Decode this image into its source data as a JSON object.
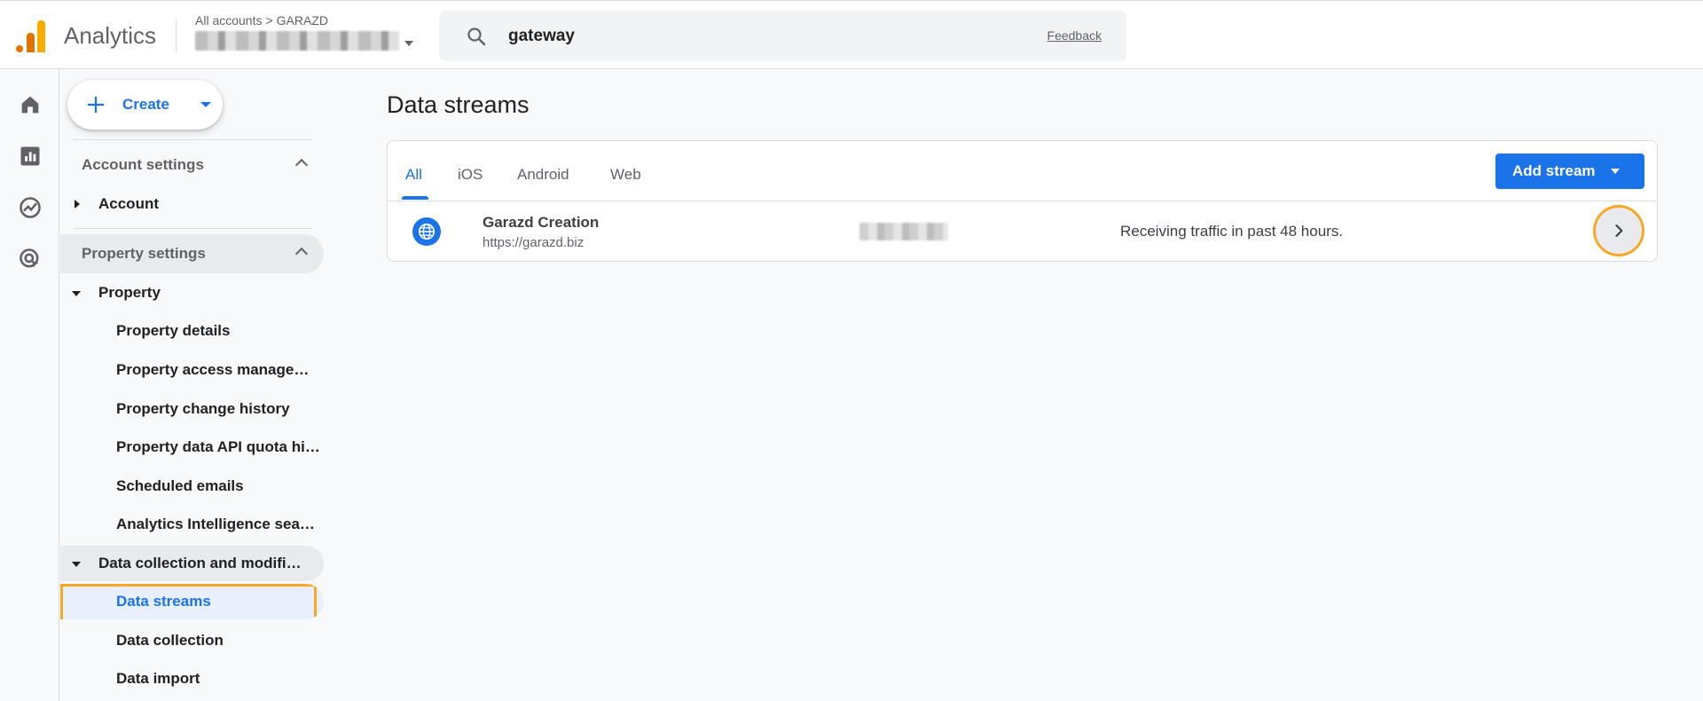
{
  "header": {
    "app_title": "Analytics",
    "breadcrumb": {
      "root": "All accounts",
      "separator": ">",
      "account": "GARAZD"
    },
    "search": {
      "value": "gateway",
      "placeholder": ""
    },
    "feedback_label": "Feedback"
  },
  "rail": {
    "icons": [
      "home-icon",
      "reports-icon",
      "explore-icon",
      "advertising-icon"
    ]
  },
  "nav": {
    "create_label": "Create",
    "account_settings": {
      "title": "Account settings",
      "items": [
        {
          "label": "Account"
        }
      ]
    },
    "property_settings": {
      "title": "Property settings",
      "property_label": "Property",
      "property_items": [
        {
          "label": "Property details"
        },
        {
          "label": "Property access management"
        },
        {
          "label": "Property change history"
        },
        {
          "label": "Property data API quota history"
        },
        {
          "label": "Scheduled emails"
        },
        {
          "label": "Analytics Intelligence search history"
        }
      ],
      "data_collection_label": "Data collection and modification",
      "data_collection_items": [
        {
          "label": "Data streams",
          "active": true
        },
        {
          "label": "Data collection"
        },
        {
          "label": "Data import"
        }
      ]
    }
  },
  "main": {
    "page_title": "Data streams",
    "tabs": [
      {
        "label": "All",
        "active": true
      },
      {
        "label": "iOS"
      },
      {
        "label": "Android"
      },
      {
        "label": "Web"
      }
    ],
    "add_stream_label": "Add stream",
    "streams": [
      {
        "name": "Garazd Creation",
        "url": "https://garazd.biz",
        "status": "Receiving traffic in past 48 hours."
      }
    ]
  },
  "colors": {
    "accent": "#1a73e8",
    "highlight": "#f9a825",
    "logo_orange": "#e37400",
    "logo_yellow": "#f9ab00"
  }
}
